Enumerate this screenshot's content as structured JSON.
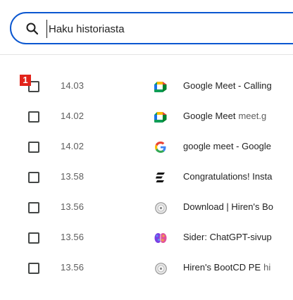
{
  "search": {
    "placeholder": "Haku historiasta"
  },
  "badge": "1",
  "history": [
    {
      "time": "14.03",
      "title": "Google Meet - Calling",
      "domain": "",
      "icon": "google-meet-icon"
    },
    {
      "time": "14.02",
      "title": "Google Meet",
      "domain": "meet.g",
      "icon": "google-meet-icon"
    },
    {
      "time": "14.02",
      "title": "google meet - Google",
      "domain": "",
      "icon": "google-g-icon"
    },
    {
      "time": "13.58",
      "title": "Congratulations! Insta",
      "domain": "",
      "icon": "site-logo-icon"
    },
    {
      "time": "13.56",
      "title": "Download | Hiren's Bo",
      "domain": "",
      "icon": "hirens-bootcd-icon"
    },
    {
      "time": "13.56",
      "title": "Sider: ChatGPT-sivup",
      "domain": "",
      "icon": "sider-brain-icon"
    },
    {
      "time": "13.56",
      "title": "Hiren's BootCD PE",
      "domain": "hi",
      "icon": "hirens-bootcd-icon"
    }
  ],
  "colors": {
    "accent": "#0b57d0",
    "badge": "#e2231a"
  }
}
